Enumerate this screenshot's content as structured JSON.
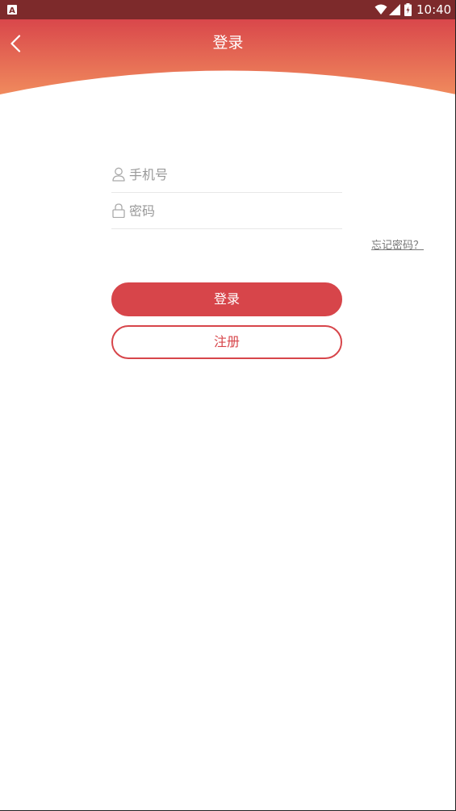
{
  "status_bar": {
    "time": "10:40",
    "icons": [
      "app-notification-icon",
      "wifi-icon",
      "signal-icon",
      "battery-icon"
    ]
  },
  "header": {
    "title": "登录",
    "back_icon": "chevron-left-icon",
    "colors": {
      "gradient_top": "#d9474b",
      "gradient_bottom": "#f08a5d"
    }
  },
  "form": {
    "phone": {
      "placeholder": "手机号",
      "value": "",
      "icon": "user-icon"
    },
    "password": {
      "placeholder": "密码",
      "value": "",
      "icon": "lock-icon"
    },
    "forgot_password": "忘记密码？"
  },
  "buttons": {
    "login_label": "登录",
    "register_label": "注册"
  },
  "colors": {
    "accent": "#d7454a",
    "status_bar": "#7d2a2b",
    "placeholder": "#999999"
  }
}
